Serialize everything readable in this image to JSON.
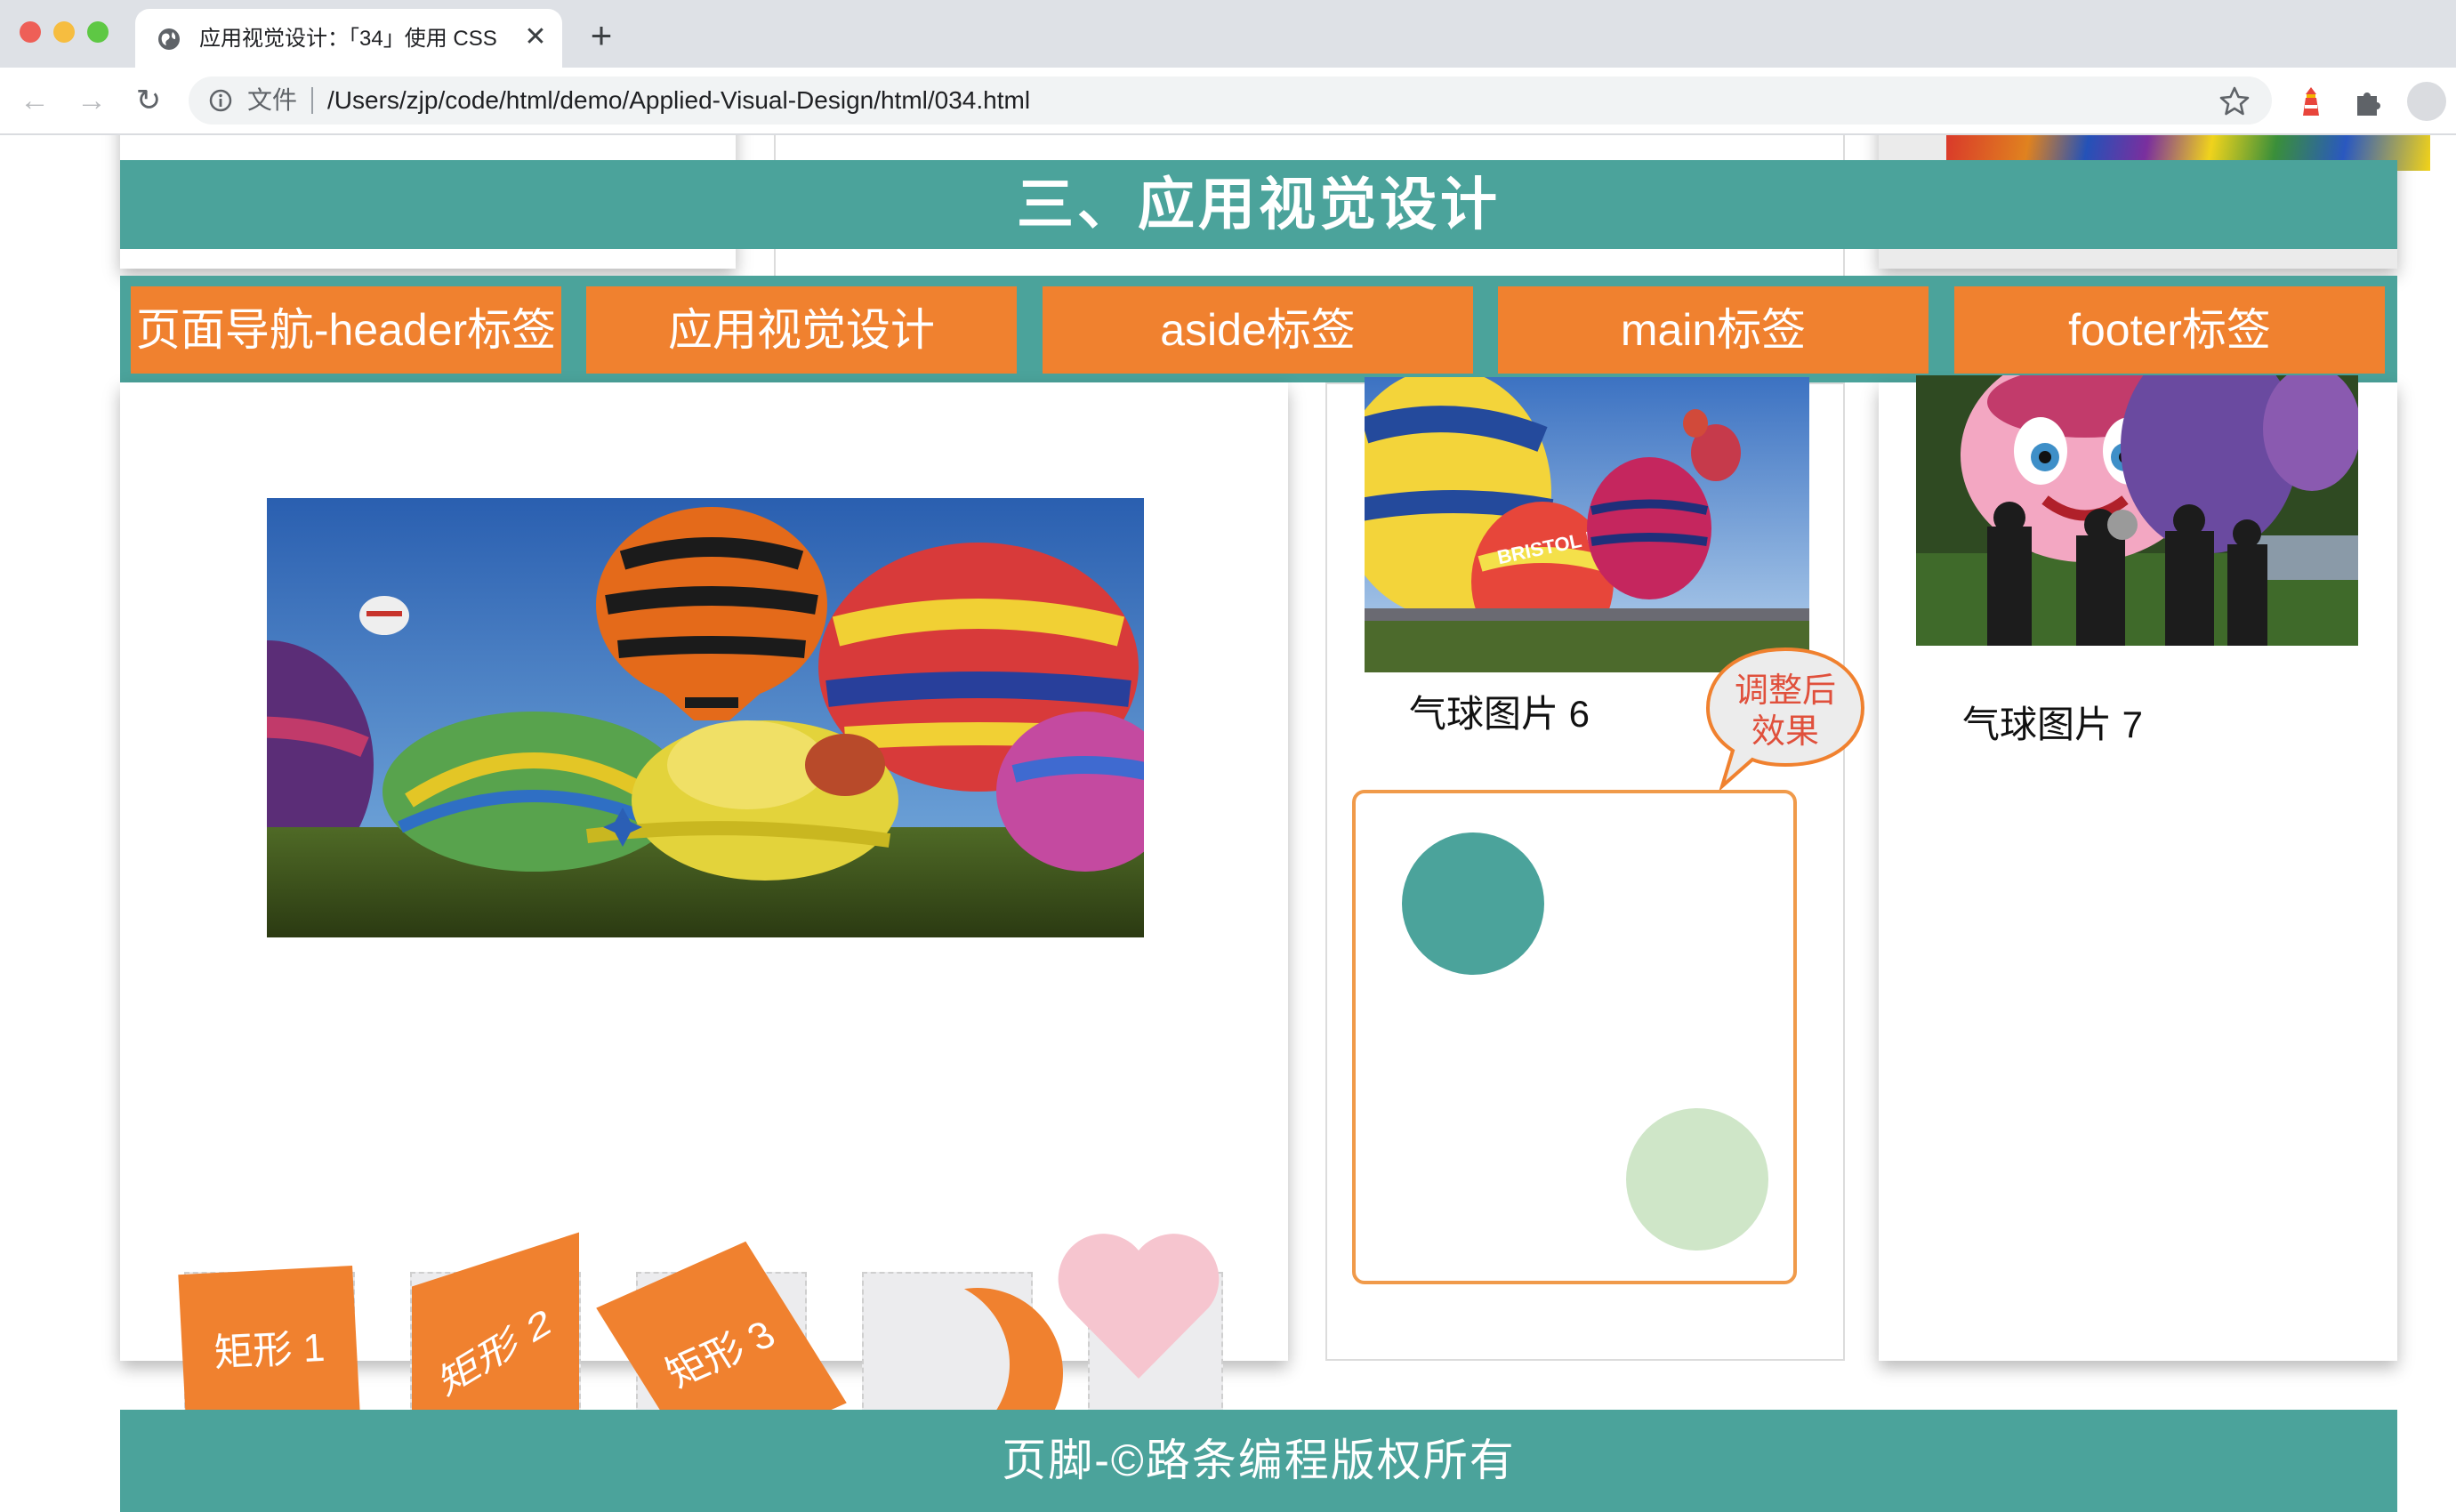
{
  "browser": {
    "tab_title": "应用视觉设计：「34」使用 CSS",
    "tab_close": "✕",
    "new_tab": "+",
    "file_label": "文件",
    "url": "/Users/zjp/code/html/demo/Applied-Visual-Design/html/034.html"
  },
  "header": {
    "title": "三、应用视觉设计"
  },
  "nav": {
    "items": [
      {
        "label": "页面导航-header标签"
      },
      {
        "label": "应用视觉设计"
      },
      {
        "label": "aside标签"
      },
      {
        "label": "main标签"
      },
      {
        "label": "footer标签"
      }
    ]
  },
  "gallery": {
    "caption_6": "气球图片 6",
    "caption_7": "气球图片 7",
    "balloon_text": "BRISTOL BALLOON"
  },
  "speech_bubble": {
    "line1": "调整后",
    "line2": "效果"
  },
  "shapes": {
    "rect1": "矩形 1",
    "rect2": "矩形 2",
    "rect3": "矩形 3"
  },
  "footer": {
    "text": "页脚-©路条编程版权所有"
  },
  "colors": {
    "teal": "#4ba39b",
    "orange": "#f0812f",
    "pink": "#f6c5cf",
    "light_green": "#cfe6c8",
    "bubble_text": "#e0503c"
  }
}
